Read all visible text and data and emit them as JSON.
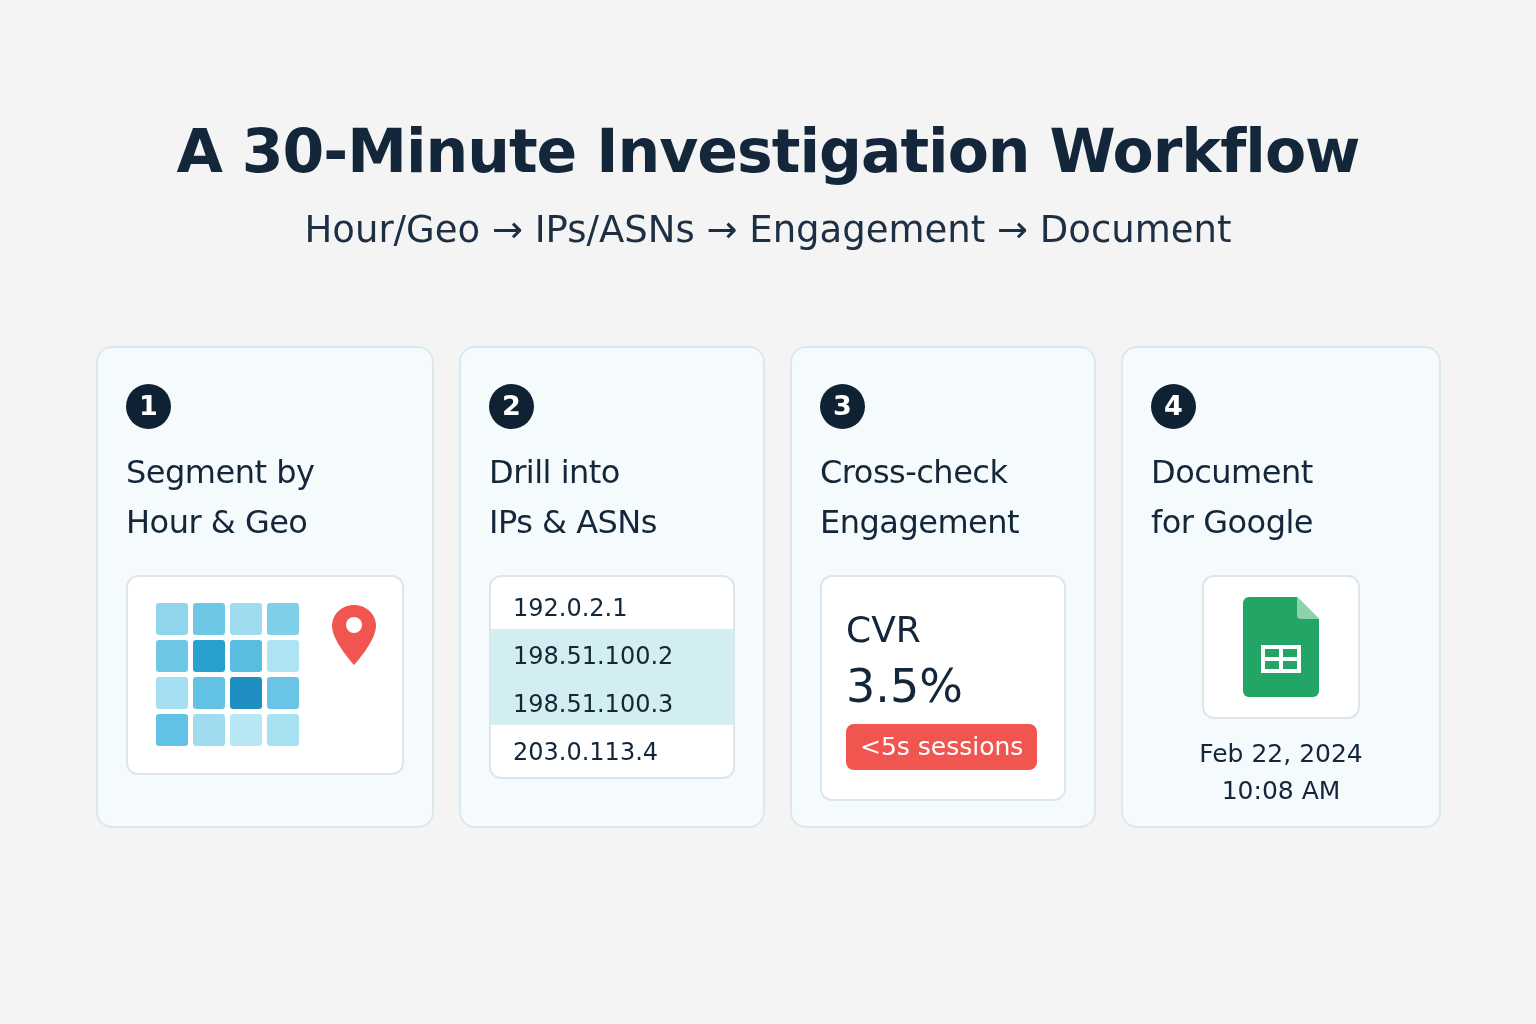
{
  "title": "A 30-Minute Investigation Workflow",
  "subtitle": "Hour/Geo → IPs/ASNs → Engagement → Document",
  "steps": [
    {
      "kind": "heatmap",
      "number": "1",
      "title": [
        "Segment by",
        "Hour & Geo"
      ]
    },
    {
      "kind": "iplist",
      "number": "2",
      "title": [
        "Drill into",
        "IPs & ASNs"
      ],
      "rows": [
        {
          "text": "192.0.2.1",
          "selected": false
        },
        {
          "text": "198.51.100.2",
          "selected": true
        },
        {
          "text": "198.51.100.3",
          "selected": true
        },
        {
          "text": "203.0.113.4",
          "selected": false
        }
      ]
    },
    {
      "kind": "metric",
      "number": "3",
      "title": [
        "Cross-check",
        "Engagement"
      ],
      "metric_label": "CVR",
      "metric_value": "3.5%",
      "badge": "<5s sessions"
    },
    {
      "kind": "document",
      "number": "4",
      "title": [
        "Document",
        "for Google"
      ],
      "date": "Feb 22, 2024",
      "time": "10:08 AM"
    }
  ]
}
